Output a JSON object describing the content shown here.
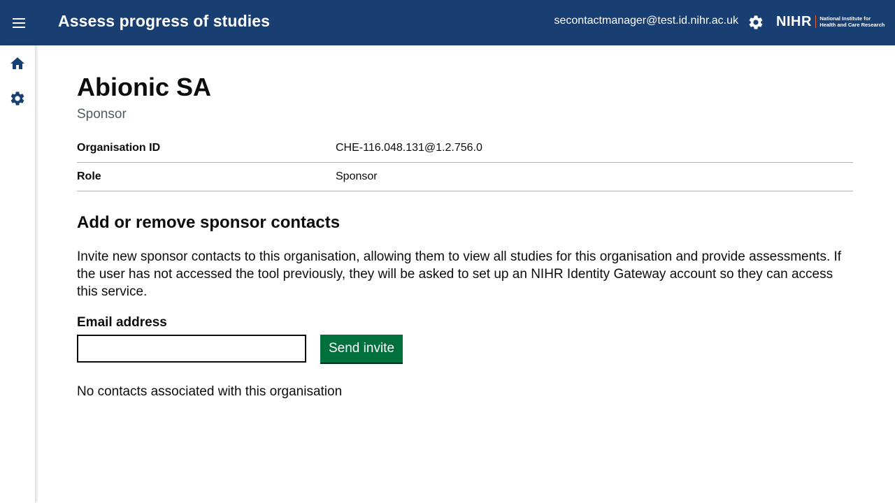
{
  "header": {
    "app_title": "Assess progress of studies",
    "user_email": "secontactmanager@test.id.nihr.ac.uk",
    "logo": {
      "wordmark": "NIHR",
      "subtext_line1": "National Institute for",
      "subtext_line2": "Health and Care Research",
      "accent_color": "#e4602a"
    },
    "background_color": "#193e72",
    "menu_icon": "hamburger-icon",
    "settings_icon": "gear-icon"
  },
  "sidebar": {
    "items": [
      {
        "icon": "home-icon"
      },
      {
        "icon": "gear-icon"
      }
    ],
    "icon_color": "#193e72"
  },
  "organisation": {
    "name": "Abionic SA",
    "caption": "Sponsor",
    "summary": [
      {
        "key": "Organisation ID",
        "value": "CHE-116.048.131@1.2.756.0"
      },
      {
        "key": "Role",
        "value": "Sponsor"
      }
    ]
  },
  "contacts": {
    "heading": "Add or remove sponsor contacts",
    "description": "Invite new sponsor contacts to this organisation, allowing them to view all studies for this organisation and provide assessments. If the user has not accessed the tool previously, they will be asked to set up an NIHR Identity Gateway account so they can access this service.",
    "email_label": "Email address",
    "email_value": "",
    "send_button_label": "Send invite",
    "button_color": "#00703c",
    "empty_message": "No contacts associated with this organisation"
  }
}
